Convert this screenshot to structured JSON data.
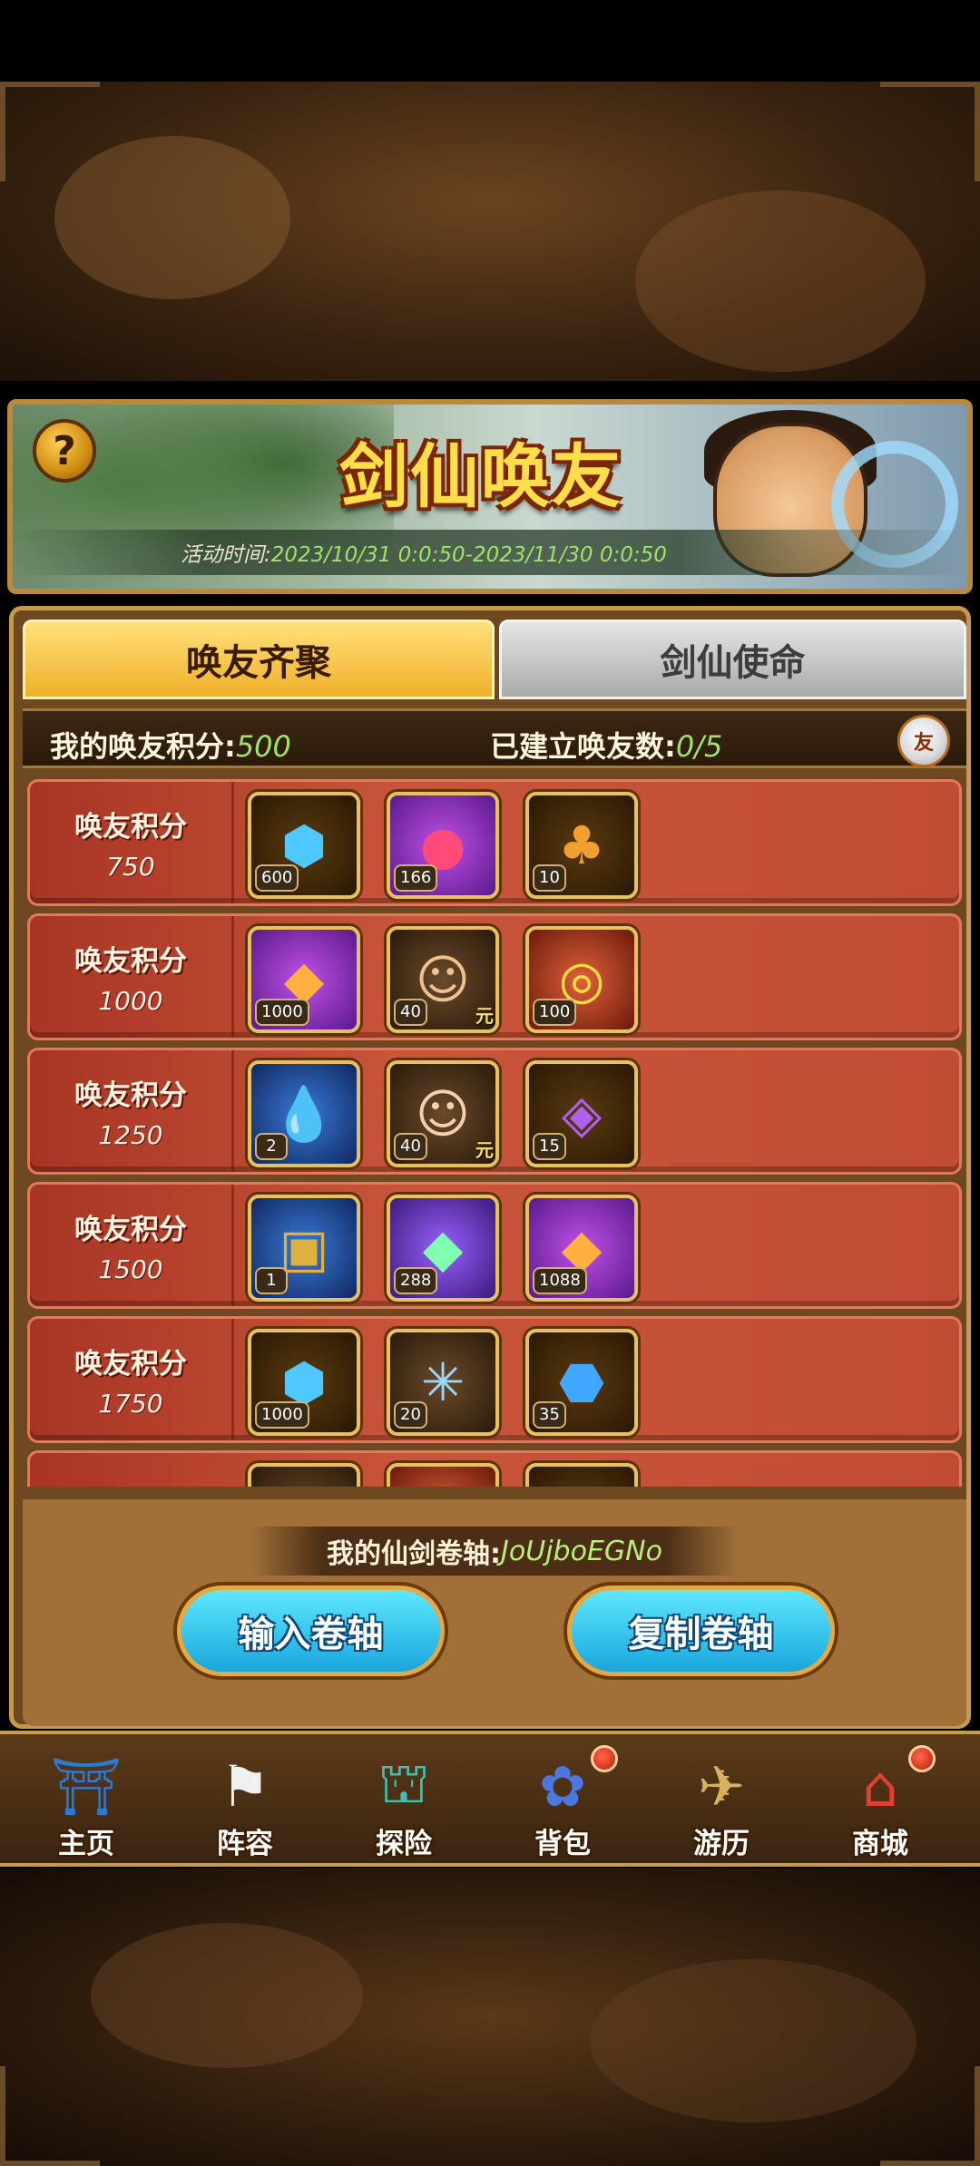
{
  "banner": {
    "title": "剑仙唤友",
    "time_label": "活动时间:",
    "time_value": "2023/10/31 0:0:50-2023/11/30 0:0:50"
  },
  "tabs": [
    {
      "label": "唤友齐聚",
      "active": true
    },
    {
      "label": "剑仙使命",
      "active": false
    }
  ],
  "stats": {
    "points_label": "我的唤友积分:",
    "points_value": "500",
    "friends_label": "已建立唤友数:",
    "friends_value": "0/5",
    "friend_icon_text": "友"
  },
  "reward_rows": [
    {
      "title": "唤友积分",
      "points": "750",
      "items": [
        {
          "icon": "blue-gem-icon",
          "qty": "600"
        },
        {
          "icon": "purple-orb-icon",
          "qty": "166"
        },
        {
          "icon": "treasure-bag-icon",
          "qty": "10"
        }
      ]
    },
    {
      "title": "唤友积分",
      "points": "1000",
      "items": [
        {
          "icon": "crystal-cluster-icon",
          "qty": "1000"
        },
        {
          "icon": "hero-portrait-icon",
          "qty": "40",
          "yuan": "元"
        },
        {
          "icon": "fire-orb-icon",
          "qty": "100"
        }
      ]
    },
    {
      "title": "唤友积分",
      "points": "1250",
      "items": [
        {
          "icon": "water-drops-icon",
          "qty": "2"
        },
        {
          "icon": "heroine-portrait-icon",
          "qty": "40",
          "yuan": "元"
        },
        {
          "icon": "purple-rune-icon",
          "qty": "15"
        }
      ]
    },
    {
      "title": "唤友积分",
      "points": "1500",
      "items": [
        {
          "icon": "treasure-chest-icon",
          "qty": "1"
        },
        {
          "icon": "rainbow-crystal-icon",
          "qty": "288"
        },
        {
          "icon": "crystal-cluster-icon",
          "qty": "1088"
        }
      ]
    },
    {
      "title": "唤友积分",
      "points": "1750",
      "items": [
        {
          "icon": "blue-gem-icon",
          "qty": "1000"
        },
        {
          "icon": "ice-swirl-icon",
          "qty": "20"
        },
        {
          "icon": "blue-crystal-orb-icon",
          "qty": "35"
        }
      ]
    }
  ],
  "scroll": {
    "label": "我的仙剑卷轴:",
    "code": "JoUjboEGNo"
  },
  "buttons": {
    "input_scroll": "输入卷轴",
    "copy_scroll": "复制卷轴"
  },
  "nav": [
    {
      "label": "主页",
      "icon": "home-icon",
      "badge": false
    },
    {
      "label": "阵容",
      "icon": "lineup-icon",
      "badge": false
    },
    {
      "label": "探险",
      "icon": "adventure-icon",
      "badge": false
    },
    {
      "label": "背包",
      "icon": "backpack-icon",
      "badge": true
    },
    {
      "label": "游历",
      "icon": "travel-icon",
      "badge": false
    },
    {
      "label": "商城",
      "icon": "shop-icon",
      "badge": true
    }
  ],
  "colors": {
    "accent_gold": "#f0b02a",
    "row_red": "#c8553a",
    "value_green": "#9fe26b",
    "button_cyan": "#1aa6dc"
  }
}
